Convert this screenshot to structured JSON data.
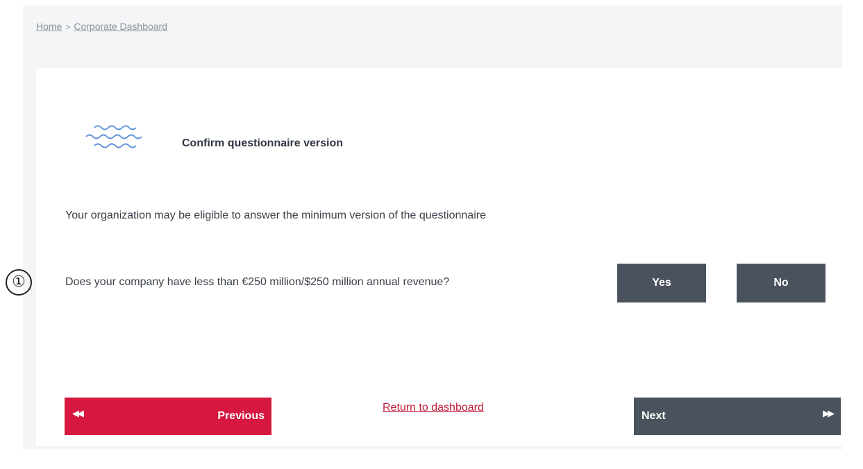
{
  "breadcrumb": {
    "home": "Home",
    "separator": ">",
    "current": "Corporate Dashboard"
  },
  "section": {
    "icon": "waves-icon",
    "title": "Confirm questionnaire version"
  },
  "intro": "Your organization may be eligible to answer the minimum version of the questionnaire",
  "question": {
    "marker": "①",
    "text": "Does your company have less than €250 million/$250 million annual revenue?",
    "yes_label": "Yes",
    "no_label": "No"
  },
  "navigation": {
    "previous_label": "Previous",
    "previous_icon": "◀◀",
    "return_label": "Return to dashboard",
    "next_label": "Next",
    "next_icon": "▶▶"
  },
  "colors": {
    "primary_red": "#d6173f",
    "dark_button": "#4a525d",
    "link_red": "#c41e3a",
    "wave_blue": "#5b8fd6"
  }
}
